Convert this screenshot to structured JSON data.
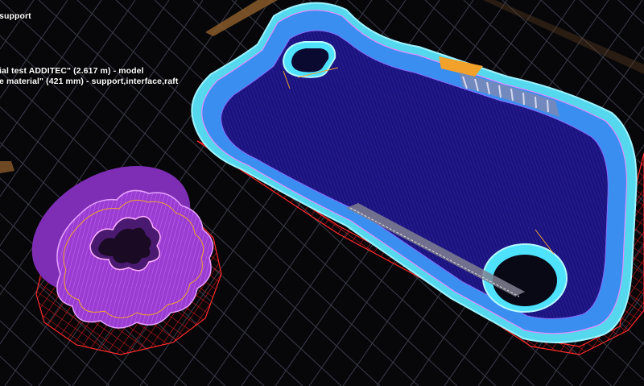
{
  "viewport": {
    "name": "3D print preview",
    "background_color": "#07070a",
    "grid_color": "#3c3c4a",
    "bed_edge_color": "#8a5a2a"
  },
  "overlay": {
    "lines": [
      "support",
      "ial test ADDITEC\" (2.617 m) - model",
      "e material\" (421 mm) - support,interface,raft"
    ]
  },
  "objects": {
    "phone_case": {
      "name": "phone case model",
      "shell_color": "#5ee6f2",
      "fill_color": "#1a1278",
      "raft_color": "#ff2a2a"
    },
    "round_part": {
      "name": "round scalloped part",
      "color": "#a13ed6",
      "raft_color": "#ff2a2a"
    }
  }
}
